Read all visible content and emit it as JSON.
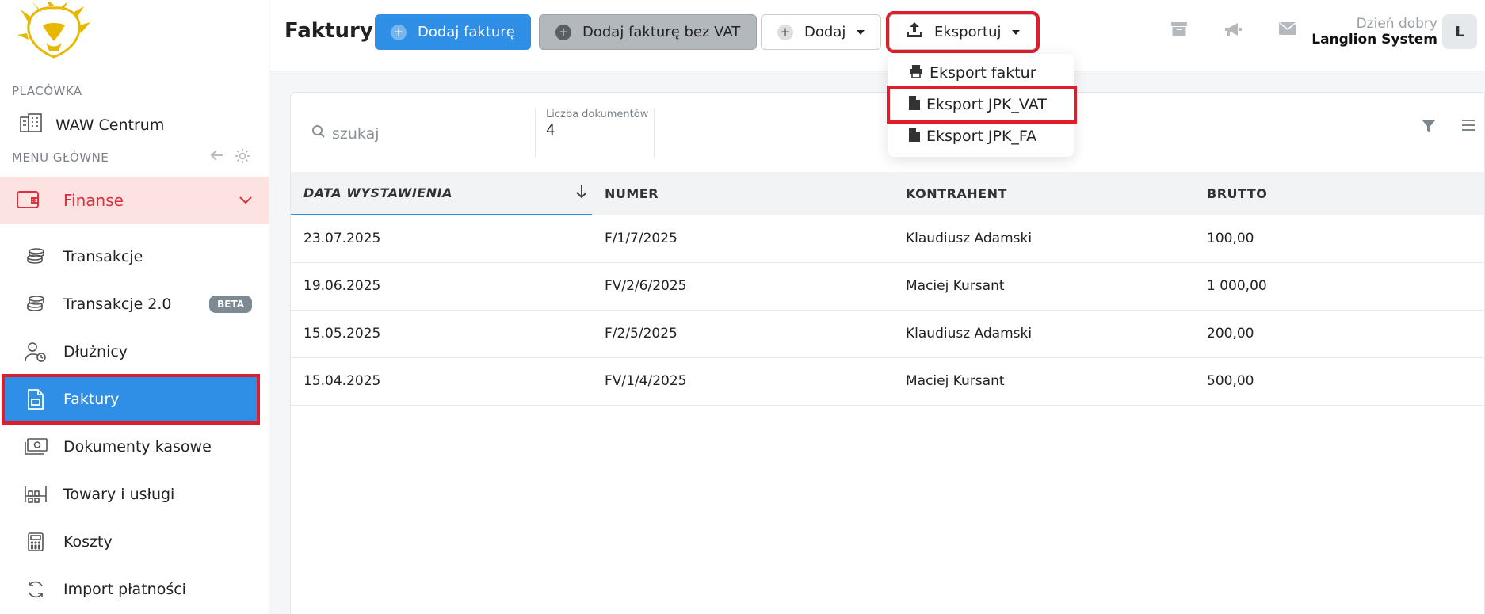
{
  "sidebar": {
    "branch_section": "PLACÓWKA",
    "branch_name": "WAW Centrum",
    "menu_section": "MENU GŁÓWNE",
    "group_label": "Finanse",
    "items": [
      {
        "label": "Transakcje",
        "icon": "coins-icon"
      },
      {
        "label": "Transakcje 2.0",
        "icon": "coins-icon",
        "badge": "BETA"
      },
      {
        "label": "Dłużnicy",
        "icon": "debtor-user-clock-icon"
      },
      {
        "label": "Faktury",
        "icon": "invoice-document-icon",
        "active": true
      },
      {
        "label": "Dokumenty kasowe",
        "icon": "cash-banknote-icon"
      },
      {
        "label": "Towary i usługi",
        "icon": "shelf-products-icon"
      },
      {
        "label": "Koszty",
        "icon": "calculator-icon"
      },
      {
        "label": "Import płatności",
        "icon": "refresh-sync-icon"
      }
    ]
  },
  "header": {
    "title": "Faktury",
    "add_invoice": "Dodaj fakturę",
    "add_invoice_no_vat": "Dodaj fakturę bez VAT",
    "add": "Dodaj",
    "export": "Eksportuj",
    "greeting": "Dzień dobry",
    "user_name": "Langlion System",
    "avatar_letter": "L"
  },
  "export_menu": {
    "items": [
      {
        "label": "Eksport faktur",
        "icon": "printer-icon"
      },
      {
        "label": "Eksport JPK_VAT",
        "icon": "file-icon"
      },
      {
        "label": "Eksport JPK_FA",
        "icon": "file-icon"
      }
    ]
  },
  "toolbar": {
    "search_placeholder": "szukaj",
    "doc_count_label": "Liczba dokumentów",
    "doc_count": "4"
  },
  "table": {
    "columns": [
      "DATA WYSTAWIENIA",
      "NUMER",
      "KONTRAHENT",
      "BRUTTO"
    ],
    "rows": [
      [
        "23.07.2025",
        "F/1/7/2025",
        "Klaudiusz Adamski",
        "100,00"
      ],
      [
        "19.06.2025",
        "FV/2/6/2025",
        "Maciej Kursant",
        "1 000,00"
      ],
      [
        "15.05.2025",
        "F/2/5/2025",
        "Klaudiusz Adamski",
        "200,00"
      ],
      [
        "15.04.2025",
        "FV/1/4/2025",
        "Maciej Kursant",
        "500,00"
      ]
    ]
  },
  "colors": {
    "accent": "#2f8ee5",
    "highlight_red": "#e01e2b",
    "finanse_bg": "#fde2e2",
    "finanse_text": "#d8323c",
    "logo_gold": "#e8b800"
  }
}
